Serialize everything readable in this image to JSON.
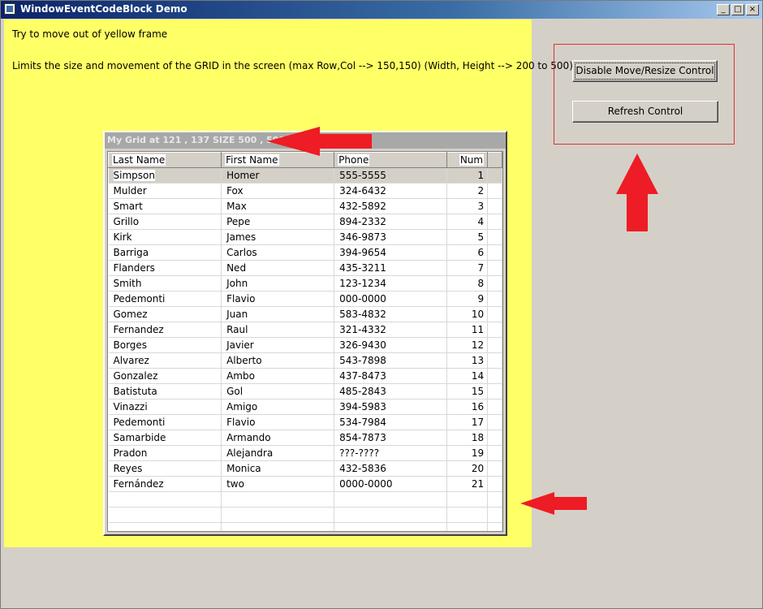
{
  "window": {
    "title": "WindowEventCodeBlock Demo",
    "minimize_glyph": "_",
    "maximize_glyph": "□",
    "close_glyph": "×"
  },
  "content": {
    "instruction": "Try to move out of yellow frame",
    "limits_text": "Limits the size and movement of the GRID in the screen (max Row,Col --> 150,150) (Width, Height --> 200 to 500)"
  },
  "grid": {
    "title": "My Grid at 121 , 137 SIZE 500 , 500",
    "columns": [
      "Last Name",
      "First Name",
      "Phone",
      "Num"
    ],
    "rows": [
      [
        "Simpson",
        "Homer",
        "555-5555",
        "1"
      ],
      [
        "Mulder",
        "Fox",
        "324-6432",
        "2"
      ],
      [
        "Smart",
        "Max",
        "432-5892",
        "3"
      ],
      [
        "Grillo",
        "Pepe",
        "894-2332",
        "4"
      ],
      [
        "Kirk",
        "James",
        "346-9873",
        "5"
      ],
      [
        "Barriga",
        "Carlos",
        "394-9654",
        "6"
      ],
      [
        "Flanders",
        "Ned",
        "435-3211",
        "7"
      ],
      [
        "Smith",
        "John",
        "123-1234",
        "8"
      ],
      [
        "Pedemonti",
        "Flavio",
        "000-0000",
        "9"
      ],
      [
        "Gomez",
        "Juan",
        "583-4832",
        "10"
      ],
      [
        "Fernandez",
        "Raul",
        "321-4332",
        "11"
      ],
      [
        "Borges",
        "Javier",
        "326-9430",
        "12"
      ],
      [
        "Alvarez",
        "Alberto",
        "543-7898",
        "13"
      ],
      [
        "Gonzalez",
        "Ambo",
        "437-8473",
        "14"
      ],
      [
        "Batistuta",
        "Gol",
        "485-2843",
        "15"
      ],
      [
        "Vinazzi",
        "Amigo",
        "394-5983",
        "16"
      ],
      [
        "Pedemonti",
        "Flavio",
        "534-7984",
        "17"
      ],
      [
        "Samarbide",
        "Armando",
        "854-7873",
        "18"
      ],
      [
        "Pradon",
        "Alejandra",
        "???-????",
        "19"
      ],
      [
        "Reyes",
        "Monica",
        "432-5836",
        "20"
      ],
      [
        "Fernández",
        "two",
        "0000-0000",
        "21"
      ]
    ],
    "empty_rows": 3,
    "selected_row": 0
  },
  "controls": {
    "disable_label": "Disable Move/Resize Control",
    "refresh_label": "Refresh Control"
  },
  "colors": {
    "yellow_area": "#ffff66",
    "arrow": "#ee1c24",
    "frame": "#e03030"
  },
  "icons": [
    "app-icon",
    "minimize-icon",
    "maximize-icon",
    "close-icon",
    "arrow-left-icon",
    "arrow-up-icon"
  ]
}
